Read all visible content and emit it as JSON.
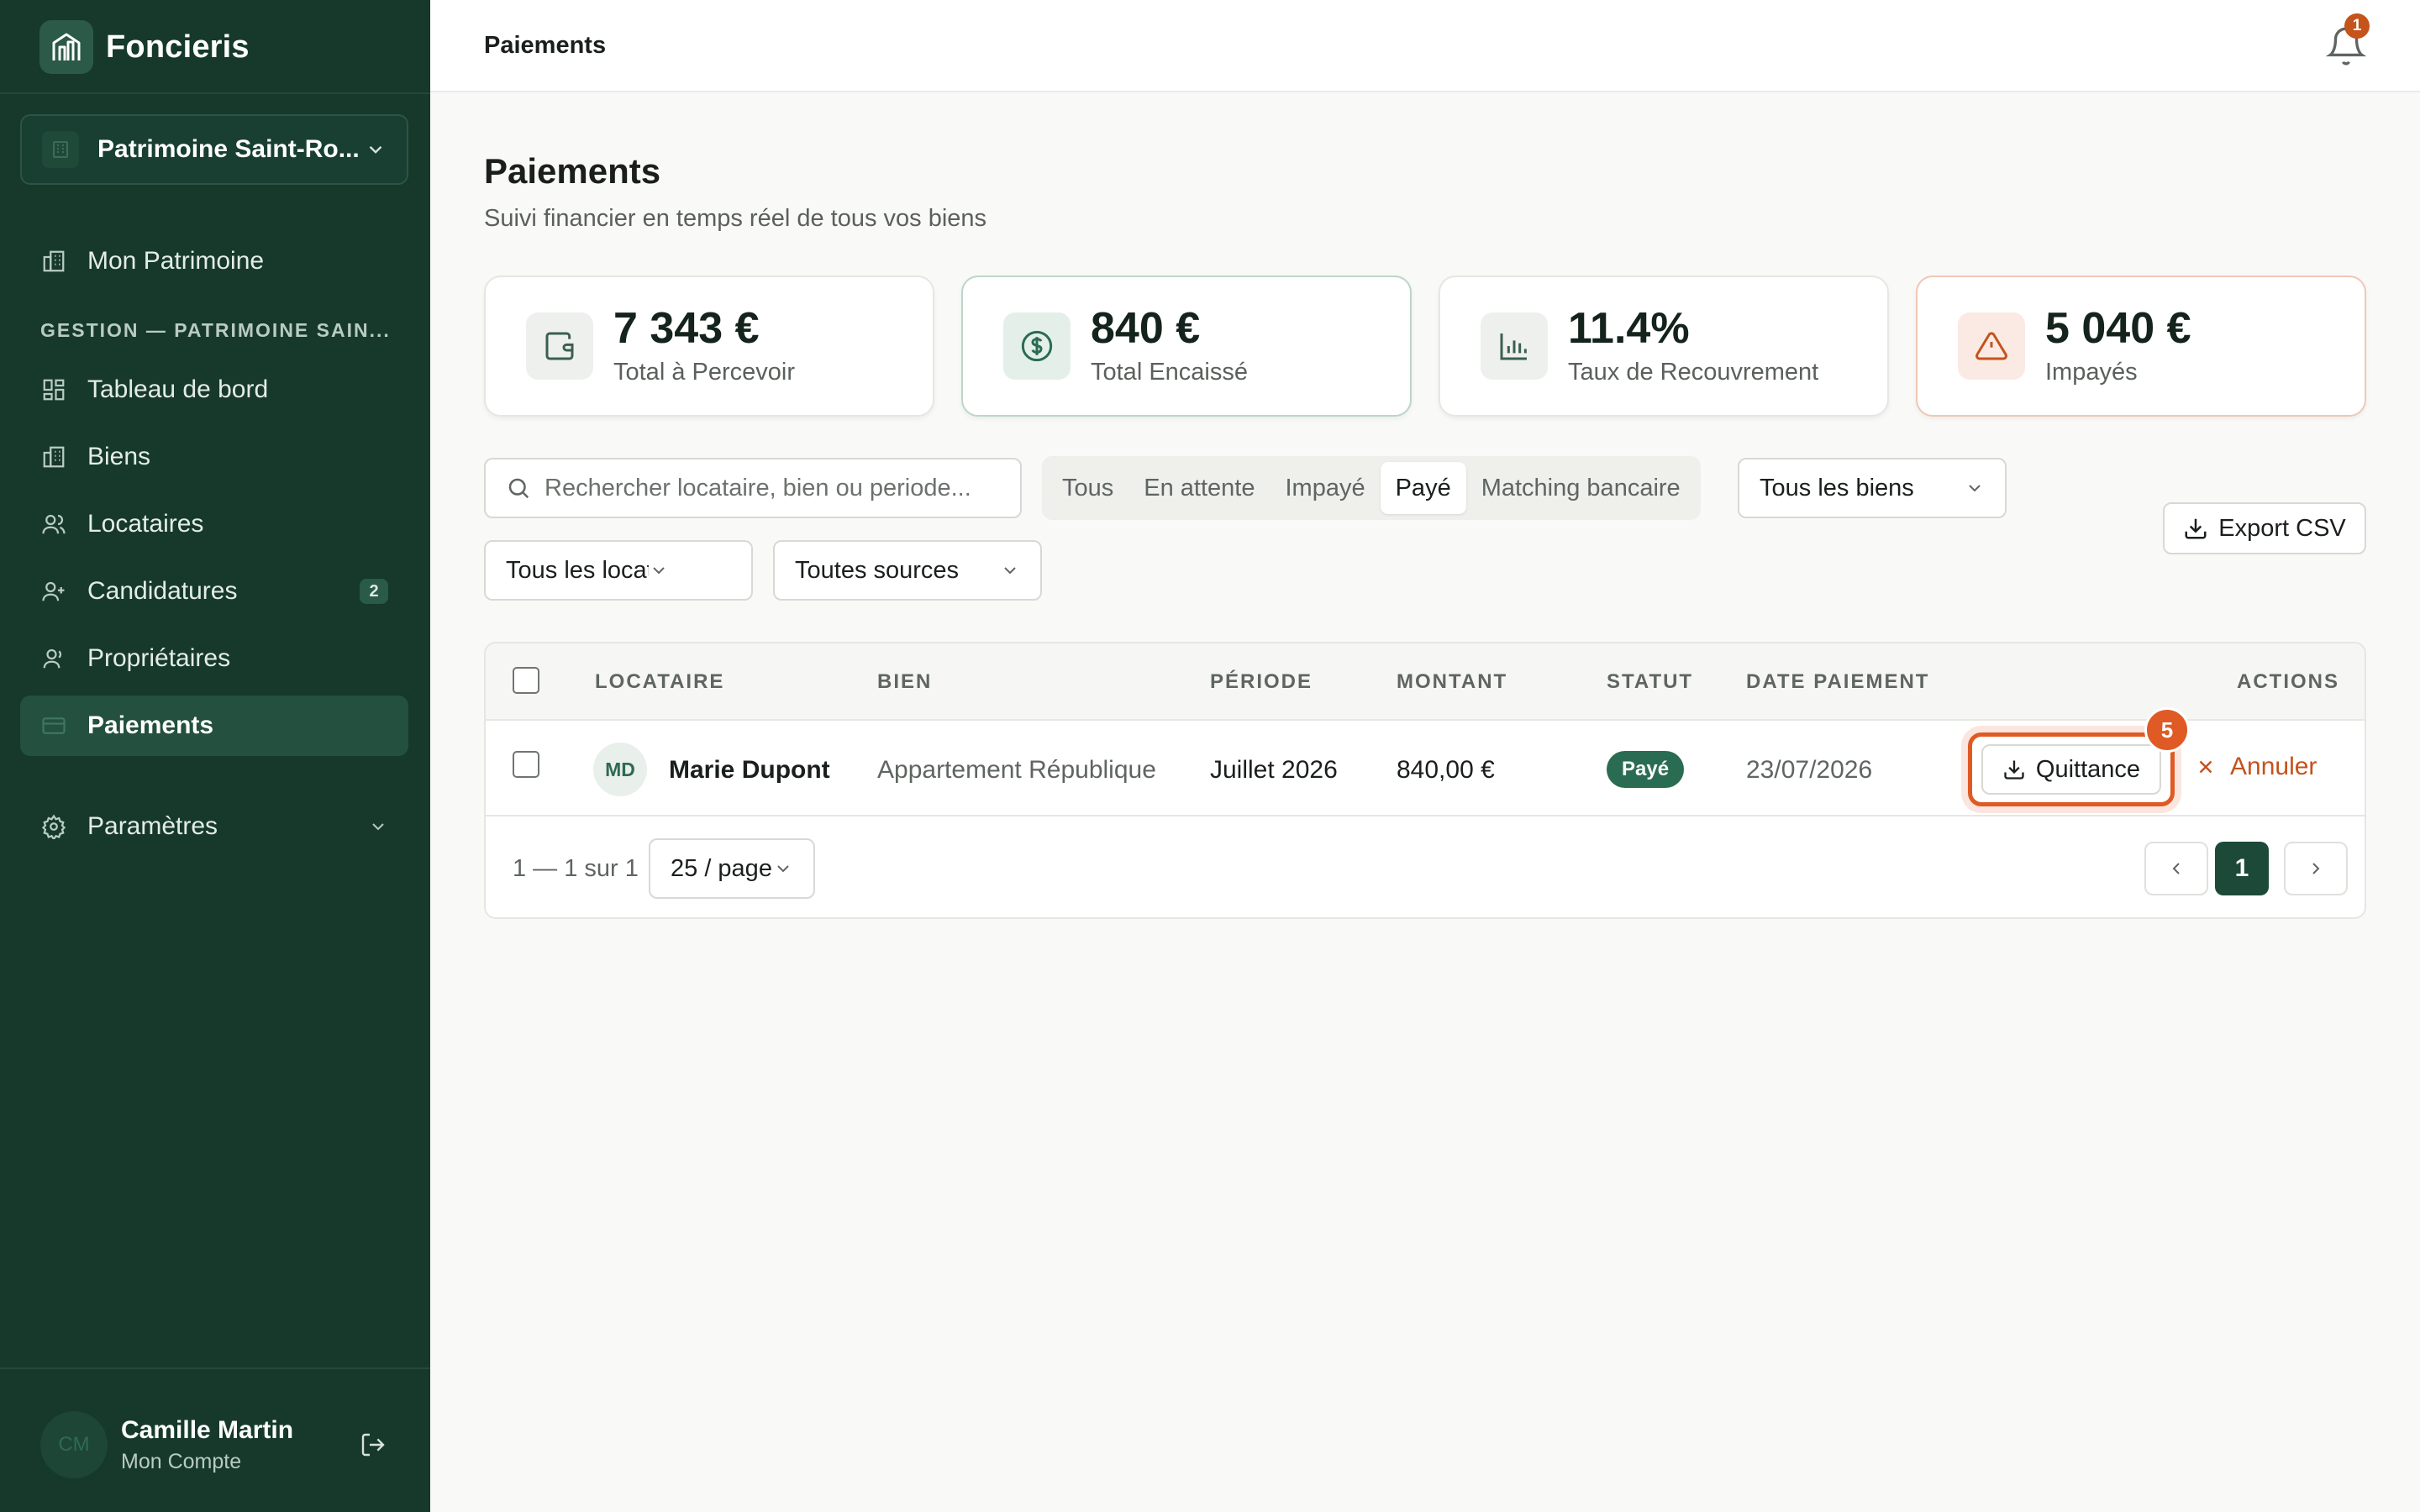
{
  "sidebar": {
    "brand": "Foncieris",
    "org_selector": "Patrimoine Saint-Ro...",
    "section_label": "GESTION — PATRIMOINE SAIN...",
    "items": [
      {
        "label": "Mon Patrimoine",
        "icon": "building-icon"
      },
      {
        "label": "Tableau de bord",
        "icon": "dashboard-icon"
      },
      {
        "label": "Biens",
        "icon": "building-icon"
      },
      {
        "label": "Locataires",
        "icon": "users-icon"
      },
      {
        "label": "Candidatures",
        "icon": "user-plus-icon",
        "badge": "2"
      },
      {
        "label": "Propriétaires",
        "icon": "user-icon"
      },
      {
        "label": "Paiements",
        "icon": "credit-card-icon",
        "active": true
      },
      {
        "label": "Paramètres",
        "icon": "gear-icon"
      }
    ],
    "user": {
      "initials": "CM",
      "name": "Camille Martin",
      "subtitle": "Mon Compte"
    }
  },
  "topbar": {
    "title": "Paiements",
    "notifications": "1"
  },
  "page": {
    "title": "Paiements",
    "subtitle": "Suivi financier en temps réel de tous vos biens"
  },
  "stats": [
    {
      "value": "7 343 €",
      "label": "Total à Percevoir",
      "icon": "wallet-icon"
    },
    {
      "value": "840 €",
      "label": "Total Encaissé",
      "icon": "dollar-circle-icon"
    },
    {
      "value": "11.4%",
      "label": "Taux de Recouvrement",
      "icon": "bar-chart-icon"
    },
    {
      "value": "5 040 €",
      "label": "Impayés",
      "icon": "warning-icon"
    }
  ],
  "filters": {
    "search_placeholder": "Rechercher locataire, bien ou periode...",
    "status_tabs": [
      "Tous",
      "En attente",
      "Impayé",
      "Payé",
      "Matching bancaire"
    ],
    "active_status": "Payé",
    "biens": "Tous les biens",
    "locataires": "Tous les locataires",
    "sources": "Toutes sources",
    "export_label": "Export CSV"
  },
  "table": {
    "columns": [
      "LOCATAIRE",
      "BIEN",
      "PÉRIODE",
      "MONTANT",
      "STATUT",
      "DATE PAIEMENT",
      "ACTIONS"
    ],
    "rows": [
      {
        "initials": "MD",
        "locataire": "Marie Dupont",
        "bien": "Appartement République",
        "periode": "Juillet 2026",
        "montant": "840,00 €",
        "statut": "Payé",
        "date": "23/07/2026",
        "action_primary": "Quittance",
        "action_secondary": "Annuler",
        "step_marker": "5"
      }
    ]
  },
  "pagination": {
    "range": "1 — 1 sur 1",
    "per_page": "25 / page",
    "current": "1"
  },
  "colors": {
    "sidebar": "#16392c",
    "accent": "#2a6c51",
    "danger": "#c4531c",
    "highlight": "#df5a24"
  }
}
